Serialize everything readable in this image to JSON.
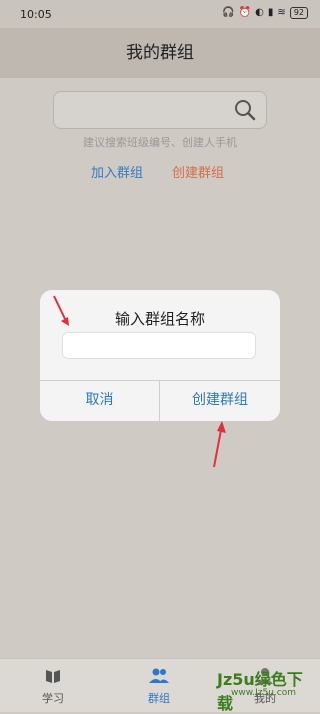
{
  "status": {
    "time": "10:05",
    "battery": "92"
  },
  "header": {
    "title": "我的群组"
  },
  "search": {
    "hint": "建议搜索班级编号、创建人手机"
  },
  "links": {
    "join": "加入群组",
    "create": "创建群组"
  },
  "dialog": {
    "title": "输入群组名称",
    "input_value": "",
    "cancel": "取消",
    "confirm": "创建群组"
  },
  "tabbar": {
    "items": [
      {
        "label": "学习",
        "icon": "book-icon"
      },
      {
        "label": "群组",
        "icon": "people-icon",
        "active": true
      },
      {
        "label": "我的",
        "icon": "user-icon"
      }
    ]
  },
  "watermark": {
    "brand": "Jz5u绿色下载",
    "url": "www.Jz5u.com"
  },
  "colors": {
    "accent": "#2e77c6",
    "create_link": "#d46e4e",
    "arrow": "#e0303f"
  }
}
